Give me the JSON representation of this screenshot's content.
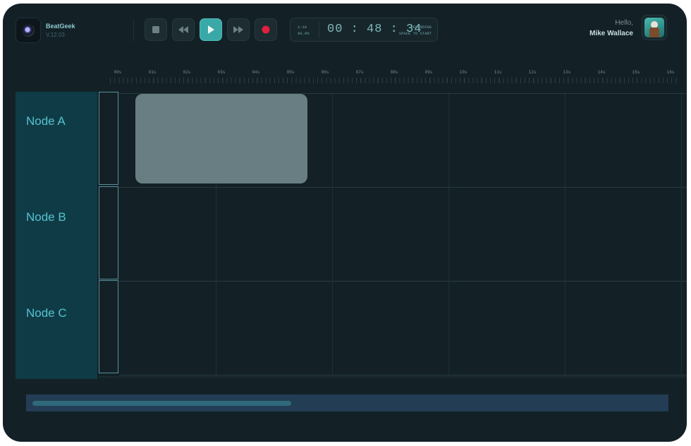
{
  "app": {
    "name": "BeatGeek",
    "version": "V.12.03"
  },
  "transport": {
    "buttons": [
      {
        "name": "stop-button",
        "icon": "stop-icon"
      },
      {
        "name": "rewind-button",
        "icon": "rewind-icon"
      },
      {
        "name": "play-button",
        "icon": "play-icon",
        "active": true
      },
      {
        "name": "fast-forward-button",
        "icon": "fast-forward-icon"
      },
      {
        "name": "record-button",
        "icon": "record-icon"
      }
    ]
  },
  "counter": {
    "left_top": "1:16",
    "left_bottom": "60.0%",
    "time": "00 : 48 : 34",
    "right_top": "RECORDING",
    "right_bottom": "SPACE TO START"
  },
  "user": {
    "greeting": "Hello,",
    "name": "Mike Wallace"
  },
  "ruler": {
    "ticks": [
      "00s",
      "01s",
      "02s",
      "03s",
      "04s",
      "05s",
      "06s",
      "07s",
      "08s",
      "09s",
      "10s",
      "11s",
      "12s",
      "13s",
      "14s",
      "15s",
      "16s"
    ]
  },
  "tracks": [
    {
      "label": "Node A"
    },
    {
      "label": "Node B"
    },
    {
      "label": "Node C"
    }
  ],
  "colors": {
    "background": "#132127",
    "accent": "#3aa8a6",
    "record": "#e0213f",
    "track_label_bg": "#0f3b47",
    "track_label_text": "#55c3cc",
    "clip": "#697e83"
  }
}
